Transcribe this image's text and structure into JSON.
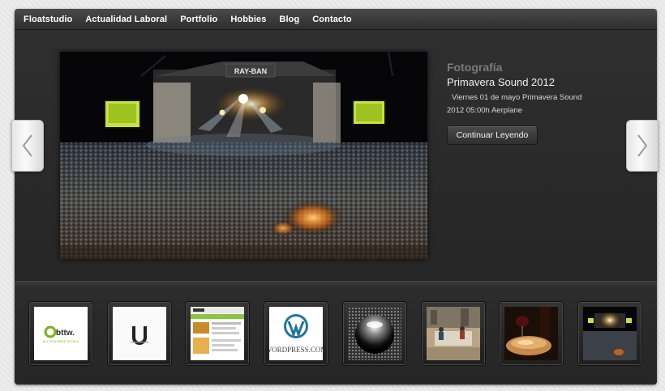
{
  "nav": {
    "items": [
      "Floatstudio",
      "Actualidad Laboral",
      "Portfolio",
      "Hobbies",
      "Blog",
      "Contacto"
    ]
  },
  "slide": {
    "category": "Fotografía",
    "title": "Primavera Sound 2012",
    "description": "Viernes 01 de mayo Primavera Sound 2012 05:00h Aerplane",
    "button_label": "Continuar Leyendo",
    "stage_banner": "RAY-BAN"
  },
  "thumbs": {
    "bttw_logo_text": "bttw.",
    "bttw_tagline": "ALL YOU NEED IS TALK",
    "wordpress_text": "WORDPRESS.COM"
  },
  "colors": {
    "frame_bg": "#2b2b2b",
    "nav_text": "#ffffff",
    "category": "#7b7b7b",
    "title": "#f2f2f2",
    "wordpress_blue": "#21759b",
    "bttw_green": "#7ab317"
  }
}
